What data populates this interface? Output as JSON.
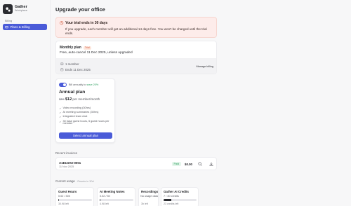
{
  "workspace": {
    "name": "Gather",
    "subtitle": "Workplace"
  },
  "sidebar": {
    "section": "Billing",
    "items": [
      {
        "label": "Plans & Billing",
        "icon": "card-icon",
        "active": true
      }
    ]
  },
  "page": {
    "title": "Upgrade your office"
  },
  "trial": {
    "title": "Your trial ends in 30 days",
    "body": "If you upgrade, each member will get an additional 14 days free. You won't be charged until the trial ends."
  },
  "current_plan": {
    "title": "Monthly plan",
    "badge": "Trial",
    "description": "Free, auto-cancel 11 Dec 2025, unless upgraded",
    "members": "1 member",
    "ends": "Ends 11 Dec 2025",
    "manage_label": "Manage billing"
  },
  "annual_offer": {
    "toggle_on": true,
    "bill_text": "Bill annually to",
    "save_text": "save 20%",
    "title": "Annual plan",
    "price_old": "$15",
    "price_new": "$12",
    "price_unit": "per member/month",
    "features": [
      "Video recording (30hrs)",
      "AI meeting summaries (30hrs)",
      "Integrated team chat",
      "30 base guest hours, 5 guest hours per member"
    ],
    "cta": "Select annual plan"
  },
  "invoices": {
    "label": "Recent invoices",
    "rows": [
      {
        "id": "A1E1GH2-0001",
        "date": "11 Nov 2025",
        "status": "Paid",
        "amount": "$0.00"
      }
    ]
  },
  "usage": {
    "label": "Current usage",
    "sublabel": "· Resets in 30d",
    "cards": [
      {
        "title": "Guest Hours",
        "value": "0.02 / 30h",
        "remaining": "30.98 left",
        "fraction": 0.01
      },
      {
        "title": "AI Meeting Notes",
        "value": "0.02 / 5h",
        "remaining": "4.98 left",
        "fraction": 0.01
      },
      {
        "title": "Recordings",
        "value": "No usage data",
        "remaining": "3h left",
        "fraction": 0
      },
      {
        "title": "Gather AI Credits",
        "value": "7 / 30 credits",
        "remaining": "23 credits left",
        "fraction": 0.23
      }
    ]
  },
  "colors": {
    "accent": "#4a5bd8",
    "trial_bg": "#fdecea",
    "paid": "#2a9d5c"
  }
}
